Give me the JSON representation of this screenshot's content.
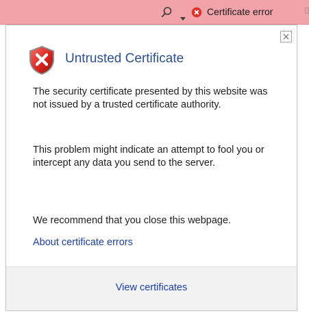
{
  "topbar": {
    "search_icon": "search-icon",
    "dropdown_icon": "chevron-down-icon",
    "error_icon": "shield-error-icon",
    "certificate_error_label": "Certificate error",
    "background_color": "#f1a3a9"
  },
  "popup": {
    "close_icon": "close-icon",
    "close_label": "×",
    "shield_icon": "shield-error-icon",
    "title": "Untrusted Certificate",
    "title_color": "#2b4f8f",
    "paragraph1": "The security certificate presented by this website was not issued by a trusted certificate authority.",
    "paragraph2": "This problem might indicate an attempt to fool you or intercept any data you send to the server.",
    "paragraph3": "We recommend that you close this webpage.",
    "about_link": "About certificate errors",
    "link_color": "#1a3da8"
  },
  "footer": {
    "view_certificates_label": "View certificates"
  }
}
